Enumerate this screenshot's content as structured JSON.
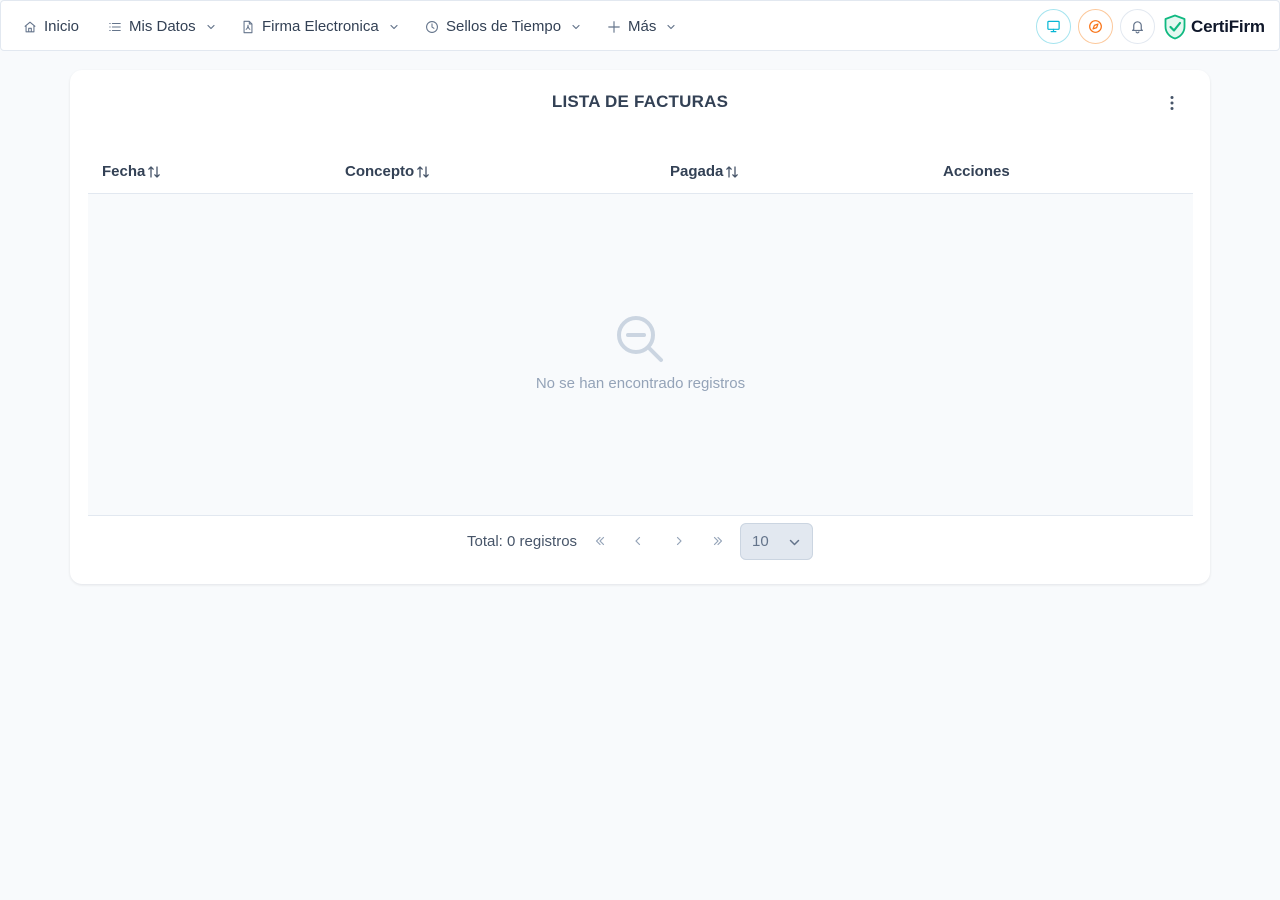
{
  "nav": {
    "items": [
      {
        "label": "Inicio",
        "icon": "home-icon",
        "has_dropdown": false
      },
      {
        "label": "Mis Datos",
        "icon": "list-icon",
        "has_dropdown": true
      },
      {
        "label": "Firma Electronica",
        "icon": "file-pdf-icon",
        "has_dropdown": true
      },
      {
        "label": "Sellos de Tiempo",
        "icon": "clock-icon",
        "has_dropdown": true
      },
      {
        "label": "Más",
        "icon": "plus-icon",
        "has_dropdown": true
      }
    ],
    "actions": [
      {
        "icon": "monitor-icon",
        "color": "#06b6d4"
      },
      {
        "icon": "compass-icon",
        "color": "#f97316"
      },
      {
        "icon": "bell-icon",
        "color": "#64748b"
      }
    ],
    "brand": {
      "name": "CertiFirm",
      "icon": "shield-check-icon",
      "color": "#10b981"
    }
  },
  "card": {
    "title": "LISTA DE FACTURAS",
    "menu_icon": "kebab-vertical-icon"
  },
  "table": {
    "columns": [
      {
        "label": "Fecha",
        "sortable": true
      },
      {
        "label": "Concepto",
        "sortable": true
      },
      {
        "label": "Pagada",
        "sortable": true
      },
      {
        "label": "Acciones",
        "sortable": false
      }
    ],
    "rows": [],
    "empty_message": "No se han encontrado registros",
    "empty_icon": "search-minus-icon"
  },
  "paginator": {
    "total_text": "Total: 0 registros",
    "rows_per_page": "10"
  },
  "colors": {
    "text": "#334155",
    "muted": "#94a3b8",
    "background": "#f8fafc",
    "border": "#e2e8f0"
  }
}
